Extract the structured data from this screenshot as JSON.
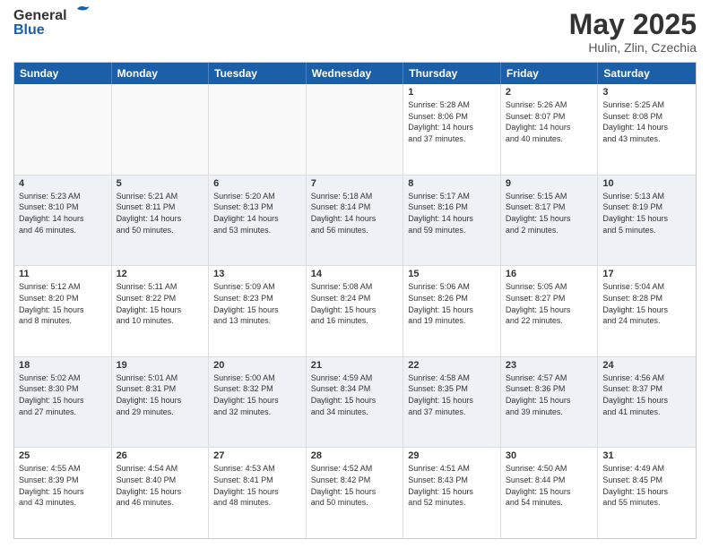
{
  "logo": {
    "general": "General",
    "blue": "Blue"
  },
  "title": "May 2025",
  "location": "Hulin, Zlin, Czechia",
  "weekdays": [
    "Sunday",
    "Monday",
    "Tuesday",
    "Wednesday",
    "Thursday",
    "Friday",
    "Saturday"
  ],
  "weeks": [
    [
      {
        "day": "",
        "info": ""
      },
      {
        "day": "",
        "info": ""
      },
      {
        "day": "",
        "info": ""
      },
      {
        "day": "",
        "info": ""
      },
      {
        "day": "1",
        "info": "Sunrise: 5:28 AM\nSunset: 8:06 PM\nDaylight: 14 hours\nand 37 minutes."
      },
      {
        "day": "2",
        "info": "Sunrise: 5:26 AM\nSunset: 8:07 PM\nDaylight: 14 hours\nand 40 minutes."
      },
      {
        "day": "3",
        "info": "Sunrise: 5:25 AM\nSunset: 8:08 PM\nDaylight: 14 hours\nand 43 minutes."
      }
    ],
    [
      {
        "day": "4",
        "info": "Sunrise: 5:23 AM\nSunset: 8:10 PM\nDaylight: 14 hours\nand 46 minutes."
      },
      {
        "day": "5",
        "info": "Sunrise: 5:21 AM\nSunset: 8:11 PM\nDaylight: 14 hours\nand 50 minutes."
      },
      {
        "day": "6",
        "info": "Sunrise: 5:20 AM\nSunset: 8:13 PM\nDaylight: 14 hours\nand 53 minutes."
      },
      {
        "day": "7",
        "info": "Sunrise: 5:18 AM\nSunset: 8:14 PM\nDaylight: 14 hours\nand 56 minutes."
      },
      {
        "day": "8",
        "info": "Sunrise: 5:17 AM\nSunset: 8:16 PM\nDaylight: 14 hours\nand 59 minutes."
      },
      {
        "day": "9",
        "info": "Sunrise: 5:15 AM\nSunset: 8:17 PM\nDaylight: 15 hours\nand 2 minutes."
      },
      {
        "day": "10",
        "info": "Sunrise: 5:13 AM\nSunset: 8:19 PM\nDaylight: 15 hours\nand 5 minutes."
      }
    ],
    [
      {
        "day": "11",
        "info": "Sunrise: 5:12 AM\nSunset: 8:20 PM\nDaylight: 15 hours\nand 8 minutes."
      },
      {
        "day": "12",
        "info": "Sunrise: 5:11 AM\nSunset: 8:22 PM\nDaylight: 15 hours\nand 10 minutes."
      },
      {
        "day": "13",
        "info": "Sunrise: 5:09 AM\nSunset: 8:23 PM\nDaylight: 15 hours\nand 13 minutes."
      },
      {
        "day": "14",
        "info": "Sunrise: 5:08 AM\nSunset: 8:24 PM\nDaylight: 15 hours\nand 16 minutes."
      },
      {
        "day": "15",
        "info": "Sunrise: 5:06 AM\nSunset: 8:26 PM\nDaylight: 15 hours\nand 19 minutes."
      },
      {
        "day": "16",
        "info": "Sunrise: 5:05 AM\nSunset: 8:27 PM\nDaylight: 15 hours\nand 22 minutes."
      },
      {
        "day": "17",
        "info": "Sunrise: 5:04 AM\nSunset: 8:28 PM\nDaylight: 15 hours\nand 24 minutes."
      }
    ],
    [
      {
        "day": "18",
        "info": "Sunrise: 5:02 AM\nSunset: 8:30 PM\nDaylight: 15 hours\nand 27 minutes."
      },
      {
        "day": "19",
        "info": "Sunrise: 5:01 AM\nSunset: 8:31 PM\nDaylight: 15 hours\nand 29 minutes."
      },
      {
        "day": "20",
        "info": "Sunrise: 5:00 AM\nSunset: 8:32 PM\nDaylight: 15 hours\nand 32 minutes."
      },
      {
        "day": "21",
        "info": "Sunrise: 4:59 AM\nSunset: 8:34 PM\nDaylight: 15 hours\nand 34 minutes."
      },
      {
        "day": "22",
        "info": "Sunrise: 4:58 AM\nSunset: 8:35 PM\nDaylight: 15 hours\nand 37 minutes."
      },
      {
        "day": "23",
        "info": "Sunrise: 4:57 AM\nSunset: 8:36 PM\nDaylight: 15 hours\nand 39 minutes."
      },
      {
        "day": "24",
        "info": "Sunrise: 4:56 AM\nSunset: 8:37 PM\nDaylight: 15 hours\nand 41 minutes."
      }
    ],
    [
      {
        "day": "25",
        "info": "Sunrise: 4:55 AM\nSunset: 8:39 PM\nDaylight: 15 hours\nand 43 minutes."
      },
      {
        "day": "26",
        "info": "Sunrise: 4:54 AM\nSunset: 8:40 PM\nDaylight: 15 hours\nand 46 minutes."
      },
      {
        "day": "27",
        "info": "Sunrise: 4:53 AM\nSunset: 8:41 PM\nDaylight: 15 hours\nand 48 minutes."
      },
      {
        "day": "28",
        "info": "Sunrise: 4:52 AM\nSunset: 8:42 PM\nDaylight: 15 hours\nand 50 minutes."
      },
      {
        "day": "29",
        "info": "Sunrise: 4:51 AM\nSunset: 8:43 PM\nDaylight: 15 hours\nand 52 minutes."
      },
      {
        "day": "30",
        "info": "Sunrise: 4:50 AM\nSunset: 8:44 PM\nDaylight: 15 hours\nand 54 minutes."
      },
      {
        "day": "31",
        "info": "Sunrise: 4:49 AM\nSunset: 8:45 PM\nDaylight: 15 hours\nand 55 minutes."
      }
    ]
  ]
}
